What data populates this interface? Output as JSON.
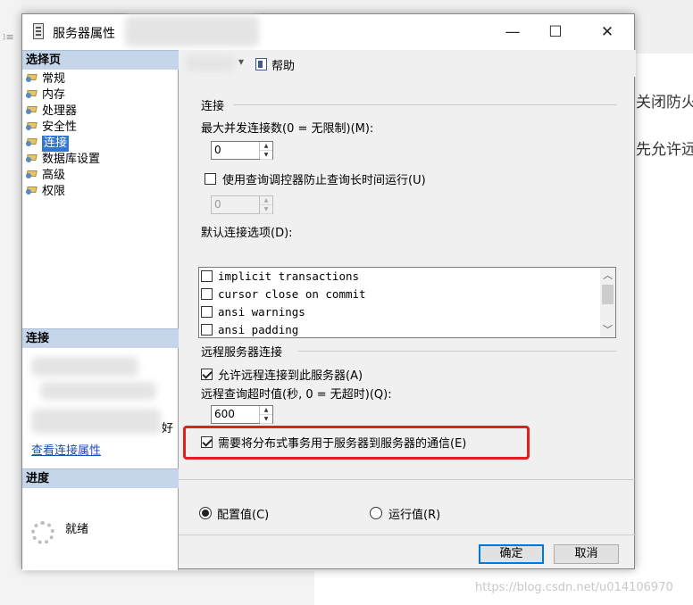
{
  "background": {
    "right_text_1": "关闭防火",
    "right_text_2": "先允许远",
    "watermark": "https://blog.csdn.net/u014106970"
  },
  "window": {
    "title": "服务器属性",
    "controls": {
      "minimize": "—",
      "maximize": "☐",
      "close": "✕"
    }
  },
  "left_pane": {
    "select_page_header": "选择页",
    "pages": [
      {
        "label": "常规",
        "selected": false
      },
      {
        "label": "内存",
        "selected": false
      },
      {
        "label": "处理器",
        "selected": false
      },
      {
        "label": "安全性",
        "selected": false
      },
      {
        "label": "连接",
        "selected": true
      },
      {
        "label": "数据库设置",
        "selected": false
      },
      {
        "label": "高级",
        "selected": false
      },
      {
        "label": "权限",
        "selected": false
      }
    ],
    "connection_header": "连接",
    "connection_trailing_char": "好",
    "view_connection_link": "查看连接属性",
    "progress_header": "进度",
    "progress_status": "就绪"
  },
  "toolbar": {
    "help_label": "帮助"
  },
  "connections": {
    "group_label": "连接",
    "max_connections_label": "最大并发连接数(0 = 无限制)(M):",
    "max_connections_value": "0",
    "query_governor_label": "使用查询调控器防止查询长时间运行(U)",
    "query_governor_checked": false,
    "query_governor_value": "0",
    "default_options_label": "默认连接选项(D):",
    "default_options": [
      {
        "label": "implicit transactions",
        "checked": false
      },
      {
        "label": "cursor close on commit",
        "checked": false
      },
      {
        "label": "ansi warnings",
        "checked": false
      },
      {
        "label": "ansi padding",
        "checked": false
      }
    ]
  },
  "remote": {
    "group_label": "远程服务器连接",
    "allow_remote_label": "允许远程连接到此服务器(A)",
    "allow_remote_checked": true,
    "timeout_label": "远程查询超时值(秒, 0 = 无超时)(Q):",
    "timeout_value": "600",
    "distributed_tx_label": "需要将分布式事务用于服务器到服务器的通信(E)",
    "distributed_tx_checked": true
  },
  "value_mode": {
    "configured_label": "配置值(C)",
    "running_label": "运行值(R)",
    "selected": "configured"
  },
  "footer": {
    "ok_label": "确定",
    "cancel_label": "取消"
  },
  "colors": {
    "selection": "#3375d7",
    "section_header": "#c5d5ea",
    "highlight_box": "#e01f1f",
    "ok_border": "#0078d7"
  }
}
